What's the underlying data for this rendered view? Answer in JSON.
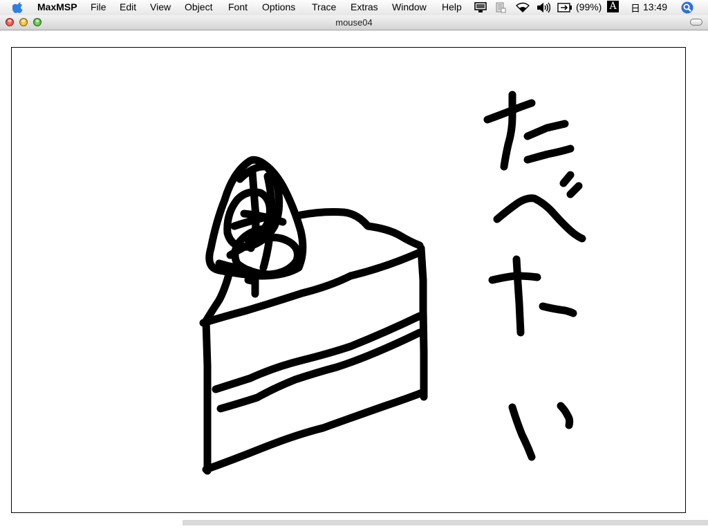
{
  "menubar": {
    "app_name": "MaxMSP",
    "items": [
      "File",
      "Edit",
      "View",
      "Object",
      "Font",
      "Options",
      "Trace",
      "Extras",
      "Window",
      "Help"
    ],
    "battery": "(99%)",
    "input_menu": "A",
    "date_glyph": "日",
    "clock": "13:49"
  },
  "window": {
    "title": "mouse04"
  },
  "canvas": {
    "stroke_color": "#000000",
    "background": "#ffffff"
  }
}
